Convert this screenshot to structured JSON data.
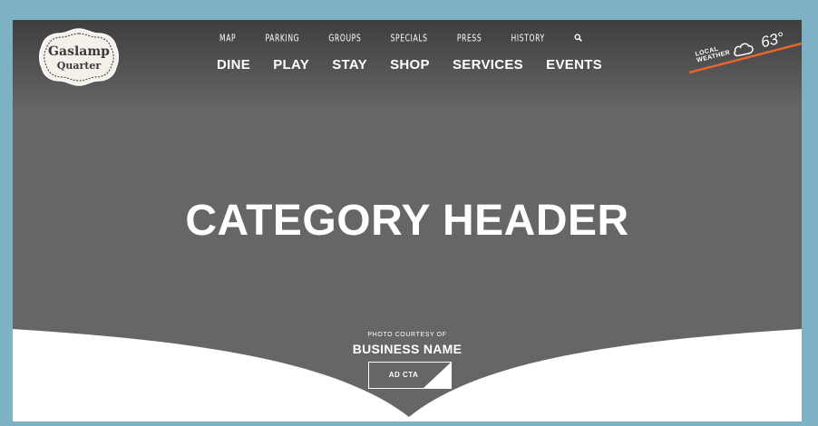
{
  "brand": {
    "logo_line1": "Gaslamp",
    "logo_line2": "Quarter"
  },
  "nav": {
    "top_items": [
      "MAP",
      "PARKING",
      "GROUPS",
      "SPECIALS",
      "PRESS",
      "HISTORY"
    ],
    "search_icon": "search-icon",
    "main_items": [
      "DINE",
      "PLAY",
      "STAY",
      "SHOP",
      "SERVICES",
      "EVENTS"
    ]
  },
  "weather": {
    "label_line1": "LOCAL",
    "label_line2": "WEATHER",
    "temperature": "63°",
    "icon": "cloud-icon",
    "accent_color": "#e8662b"
  },
  "hero": {
    "title": "CATEGORY HEADER",
    "photo_credit": "PHOTO COURTESY OF",
    "business_name": "BUSINESS NAME",
    "cta_label": "AD CTA"
  },
  "colors": {
    "frame": "#7fb1c6",
    "hero_background": "#666666",
    "header_dark": "#3d3d3d"
  }
}
